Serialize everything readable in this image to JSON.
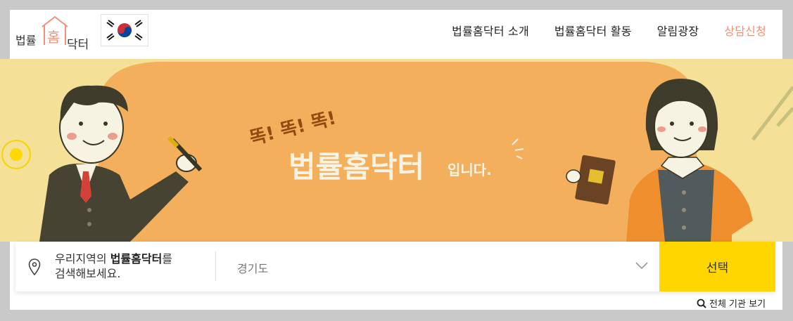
{
  "header": {
    "logo_text_left": "법률",
    "logo_text_house": "홈",
    "logo_text_right": "닥터",
    "flag_icon": "korean-flag-icon",
    "nav": [
      {
        "label": "법률홈닥터 소개"
      },
      {
        "label": "법률홈닥터 활동"
      },
      {
        "label": "알림광장"
      },
      {
        "label": "상담신청"
      }
    ]
  },
  "hero": {
    "knock_text": "똑! 똑! 똑!",
    "main_title": "법률홈닥터",
    "title_suffix": "입니다."
  },
  "search": {
    "prompt_prefix": "우리지역의 ",
    "prompt_bold": "법률홈닥터",
    "prompt_suffix": "를",
    "prompt_line2": "검색해보세요.",
    "region_value": "경기도",
    "select_label": "선택",
    "view_all_label": "전체 기관 보기"
  },
  "colors": {
    "accent_nav": "#f1917a",
    "select_button": "#ffd600",
    "hero_bg": "#fde9a8",
    "hero_blob": "#fbb061"
  }
}
